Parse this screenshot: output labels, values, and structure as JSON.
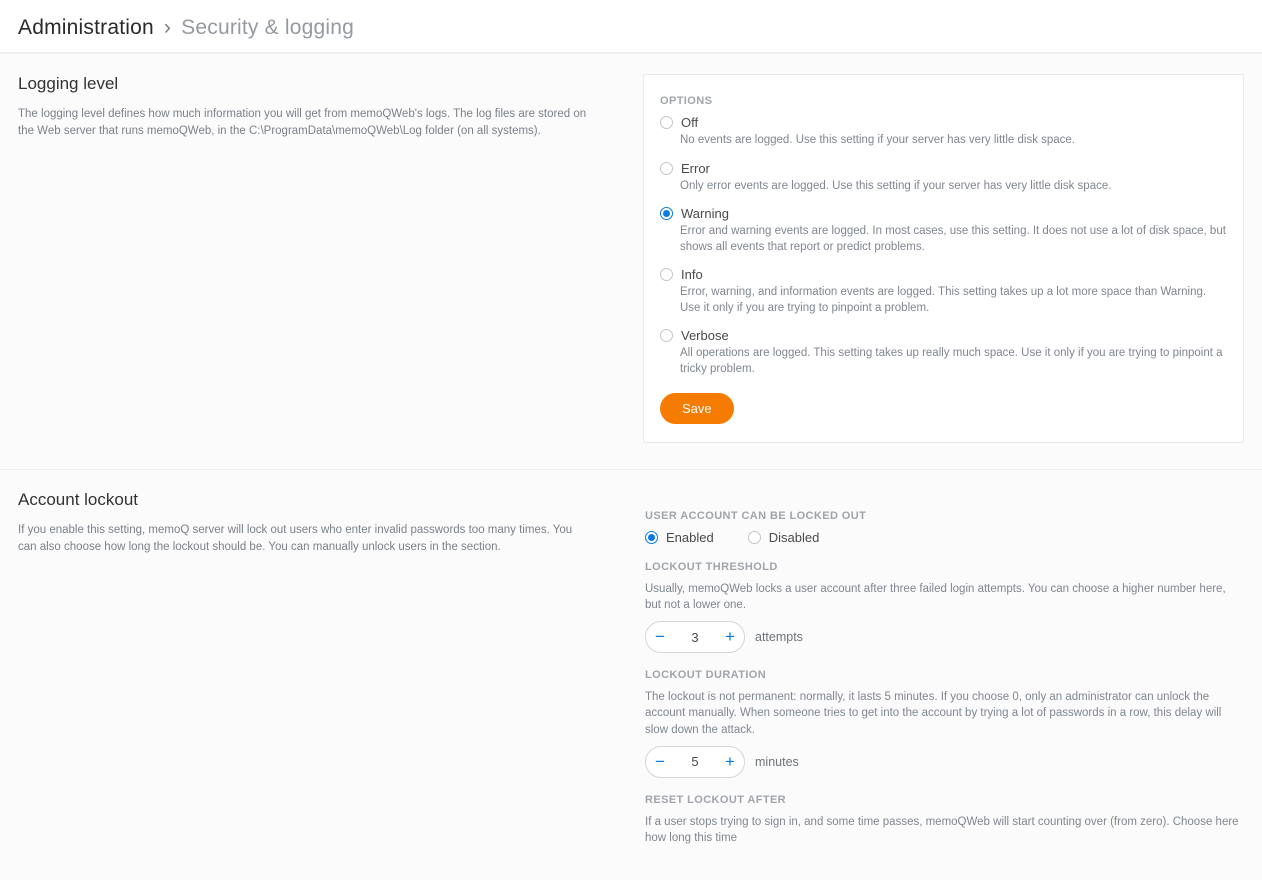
{
  "breadcrumb": {
    "root": "Administration",
    "sep": "›",
    "current": "Security & logging"
  },
  "logging": {
    "title": "Logging level",
    "desc": "The logging level defines how much information you will get from memoQWeb's logs. The log files are stored on the Web server that runs memoQWeb, in the C:\\ProgramData\\memoQWeb\\Log folder (on all systems).",
    "options_label": "OPTIONS",
    "selected": "warning",
    "options": {
      "off": {
        "label": "Off",
        "desc": "No events are logged. Use this setting if your server has very little disk space."
      },
      "error": {
        "label": "Error",
        "desc": "Only error events are logged. Use this setting if your server has very little disk space."
      },
      "warning": {
        "label": "Warning",
        "desc": "Error and warning events are logged. In most cases, use this setting. It does not use a lot of disk space, but shows all events that report or predict problems."
      },
      "info": {
        "label": "Info",
        "desc": "Error, warning, and information events are logged. This setting takes up a lot more space than Warning. Use it only if you are trying to pinpoint a problem."
      },
      "verbose": {
        "label": "Verbose",
        "desc": "All operations are logged. This setting takes up really much space. Use it only if you are trying to pinpoint a tricky problem."
      }
    },
    "save_label": "Save"
  },
  "lockout": {
    "title": "Account lockout",
    "desc": "If you enable this setting, memoQ server will lock out users who enter invalid passwords too many times. You can also choose how long the lockout should be. You can manually unlock users in the  section.",
    "enable_group_label": "USER ACCOUNT CAN BE LOCKED OUT",
    "enabled_label": "Enabled",
    "disabled_label": "Disabled",
    "enable_selected": "enabled",
    "threshold": {
      "label": "LOCKOUT THRESHOLD",
      "desc": "Usually, memoQWeb locks a user account after three failed login attempts. You can choose a higher number here, but not a lower one.",
      "value": "3",
      "unit": "attempts"
    },
    "duration": {
      "label": "LOCKOUT DURATION",
      "desc": "The lockout is not permanent: normally, it lasts 5 minutes. If you choose 0, only an administrator can unlock the account manually. When someone tries to get into the account by trying a lot of passwords in a row, this delay will slow down the attack.",
      "value": "5",
      "unit": "minutes"
    },
    "reset": {
      "label": "RESET LOCKOUT AFTER",
      "desc": "If a user stops trying to sign in, and some time passes, memoQWeb will start counting over (from zero). Choose here how long this time"
    }
  }
}
